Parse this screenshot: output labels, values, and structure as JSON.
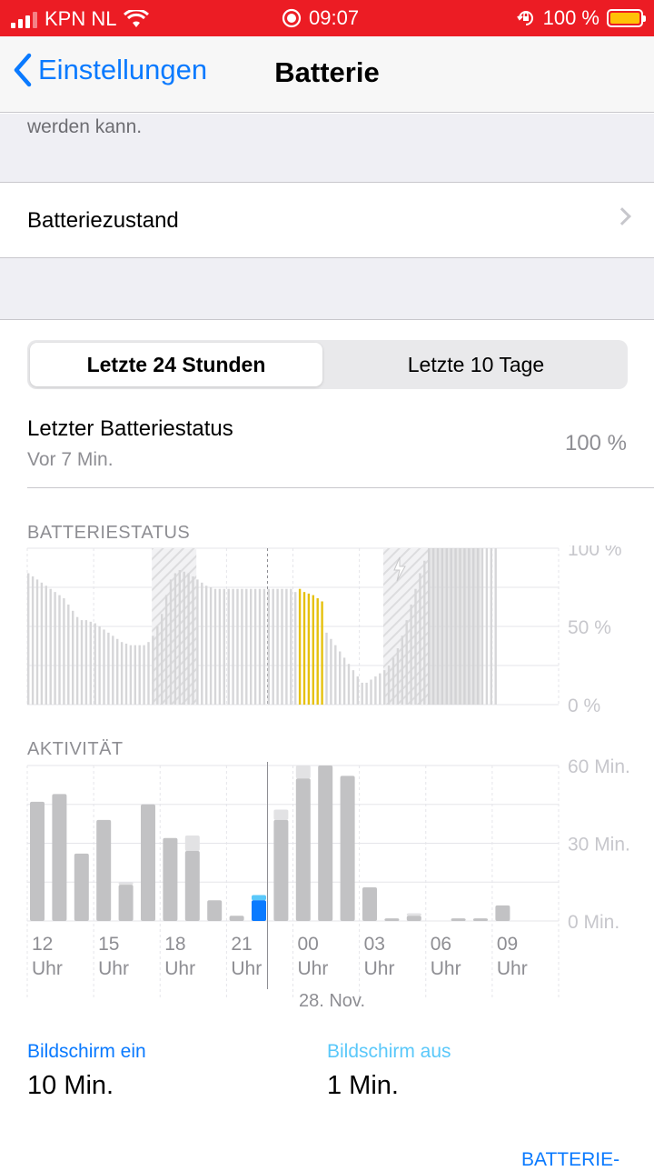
{
  "status_bar": {
    "carrier": "KPN NL",
    "time": "09:07",
    "battery_percent": "100 %"
  },
  "nav": {
    "back_label": "Einstellungen",
    "title": "Batterie"
  },
  "partial_text": "werden kann.",
  "battery_health_label": "Batteriezustand",
  "segment": {
    "options": [
      "Letzte 24 Stunden",
      "Letzte 10 Tage"
    ],
    "selected": 0
  },
  "last_status": {
    "title": "Letzter Batteriestatus",
    "subtitle": "Vor 7 Min.",
    "value": "100 %"
  },
  "battery_section_label": "BATTERIESTATUS",
  "activity_section_label": "AKTIVITÄT",
  "chart_data": [
    {
      "type": "bar",
      "title": "BATTERIESTATUS",
      "y_ticks": [
        "100 %",
        "50 %",
        "0 %"
      ],
      "ylim": [
        0,
        100
      ],
      "grid": true,
      "series": [
        {
          "values": [
            84,
            82,
            80,
            78,
            76,
            74,
            72,
            70,
            68,
            64,
            60,
            56,
            54,
            54,
            53,
            52,
            50,
            48,
            46,
            44,
            42,
            40,
            39,
            38,
            38,
            38,
            38,
            40,
            44,
            50,
            58,
            70,
            80,
            84,
            86,
            85,
            84,
            82,
            80,
            78,
            76,
            75,
            74,
            74,
            74,
            74,
            74,
            74,
            74,
            74,
            74,
            74,
            74,
            74,
            74,
            74,
            74,
            74,
            74,
            74,
            72,
            70,
            66,
            62,
            58,
            54,
            50,
            46,
            42,
            38,
            34,
            30,
            26,
            22,
            18,
            14,
            14,
            16,
            18,
            20,
            22,
            25,
            30,
            36,
            44,
            54,
            64,
            74,
            84,
            92,
            100,
            100,
            100,
            100,
            100,
            100,
            100,
            100,
            100,
            100,
            100,
            100,
            100,
            100,
            100,
            100
          ]
        }
      ],
      "highlight_range": [
        61,
        66
      ],
      "highlight_values": [
        74,
        72,
        71,
        70,
        68,
        66
      ],
      "charging_ranges": [
        [
          28,
          37
        ],
        [
          80,
          89
        ]
      ],
      "full_range": [
        90,
        105
      ],
      "colors": {
        "normal": "#d6d6d8",
        "highlight": "#e6c10d",
        "charging": "#e6e6e8"
      }
    },
    {
      "type": "bar",
      "title": "AKTIVITÄT",
      "y_ticks": [
        "60 Min.",
        "30 Min.",
        "0 Min."
      ],
      "ylim": [
        0,
        60
      ],
      "categories": [
        "12 Uhr",
        "15 Uhr",
        "18 Uhr",
        "21 Uhr",
        "00 Uhr",
        "03 Uhr",
        "06 Uhr",
        "09 Uhr"
      ],
      "date_label": "28. Nov.",
      "series": [
        {
          "name": "Bildschirm ein",
          "values": [
            46,
            49,
            26,
            39,
            14,
            45,
            32,
            27,
            8,
            2,
            8,
            39,
            55,
            60,
            56,
            13,
            1,
            2,
            0,
            1,
            1,
            6
          ]
        },
        {
          "name": "Bildschirm aus",
          "values": [
            0,
            0,
            0,
            0,
            1,
            0,
            0,
            6,
            0,
            0,
            2,
            4,
            5,
            0,
            0,
            0,
            0,
            1,
            0,
            0,
            0,
            0
          ]
        }
      ],
      "highlight_index": 10,
      "colors": {
        "on": "#c2c2c4",
        "off": "#e2e2e4",
        "on_highlight": "#0a7aff",
        "off_highlight": "#5ac8fa"
      }
    }
  ],
  "legend": {
    "screen_on_label": "Bildschirm ein",
    "screen_on_value": "10 Min.",
    "screen_off_label": "Bildschirm aus",
    "screen_off_value": "1 Min."
  },
  "bottom_link": "BATTERIE-"
}
